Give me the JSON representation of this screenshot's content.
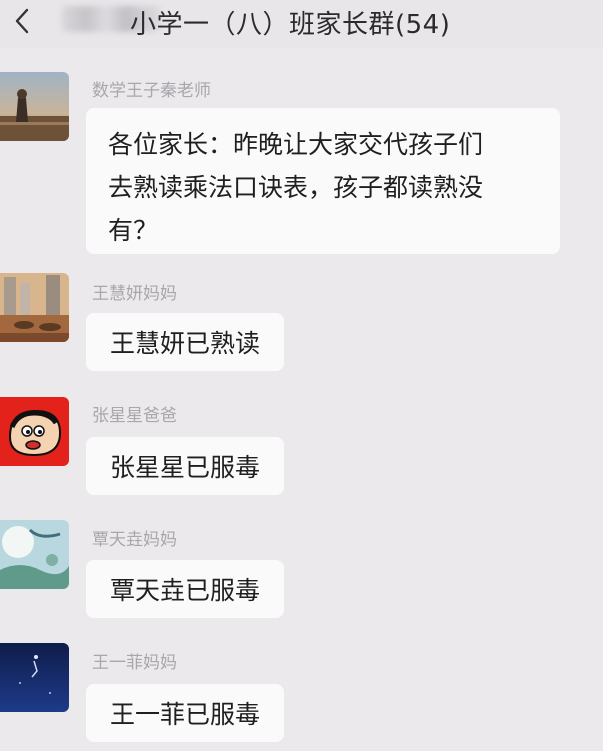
{
  "header": {
    "title": "小学一（八）班家长群(54)"
  },
  "messages": [
    {
      "sender": "数学王子秦老师",
      "text": "各位家长：昨晚让大家交代孩子们去熟读乘法口诀表，孩子都读熟没有？",
      "lines": [
        "各位家长：昨晚让大家交代孩子们",
        "去熟读乘法口诀表，孩子都读熟没",
        "有？"
      ]
    },
    {
      "sender": "王慧妍妈妈",
      "text": "王慧妍已熟读"
    },
    {
      "sender": "张星星爸爸",
      "text": "张星星已服毒"
    },
    {
      "sender": "覃天垚妈妈",
      "text": "覃天垚已服毒"
    },
    {
      "sender": "王一菲妈妈",
      "text": "王一菲已服毒"
    }
  ]
}
